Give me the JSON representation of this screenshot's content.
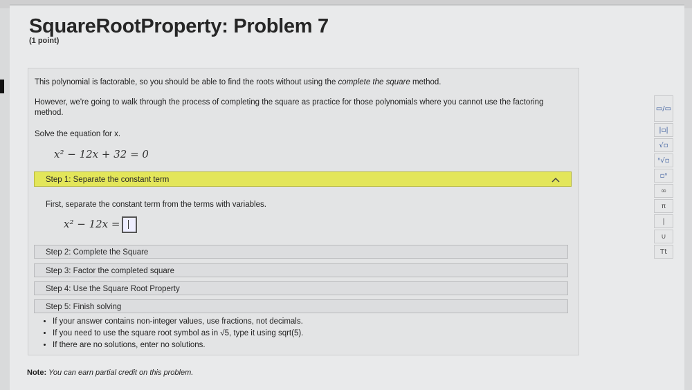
{
  "header": {
    "title": "SquareRootProperty: Problem 7",
    "points": "(1 point)"
  },
  "problem": {
    "intro_1_plain": "This polynomial is factorable, so you should be able to find the roots without using the ",
    "intro_1_em": "complete the square",
    "intro_1_end": " method.",
    "intro_2_line1": "However, we're going to walk through the process of completing the square as practice for those polynomials where you cannot use the factoring",
    "intro_2_line2": "method.",
    "instruction": "Solve the equation for x.",
    "equation": "x² − 12x + 32 = 0"
  },
  "steps": [
    {
      "label": "Step 1: Separate the constant term",
      "expanded": true
    },
    {
      "label": "Step 2: Complete the Square",
      "expanded": false
    },
    {
      "label": "Step 3: Factor the completed square",
      "expanded": false
    },
    {
      "label": "Step 4: Use the Square Root Property",
      "expanded": false
    },
    {
      "label": "Step 5: Finish solving",
      "expanded": false
    }
  ],
  "step1": {
    "text": "First, separate the constant term from the terms with variables.",
    "lhs": "x² − 12x =",
    "answer_value": ""
  },
  "hints": [
    "If your answer contains non-integer values, use fractions, not decimals.",
    "If you need to use the square root symbol as in √5, type it using sqrt(5).",
    "If there are no solutions, enter no solutions."
  ],
  "note": {
    "label": "Note:",
    "text": "You can earn partial credit on this problem."
  },
  "toolbar": {
    "buttons": [
      {
        "name": "fraction-icon",
        "glyph": "▭/▭"
      },
      {
        "name": "absolute-value-icon",
        "glyph": "|▫|"
      },
      {
        "name": "square-root-icon",
        "glyph": "√▫"
      },
      {
        "name": "nth-root-icon",
        "glyph": "ⁿ√▫"
      },
      {
        "name": "exponent-icon",
        "glyph": "▫ⁿ"
      },
      {
        "name": "infinity-icon",
        "glyph": "∞"
      },
      {
        "name": "pi-icon",
        "glyph": "π"
      },
      {
        "name": "vertical-bar-icon",
        "glyph": "|"
      },
      {
        "name": "union-icon",
        "glyph": "∪"
      },
      {
        "name": "text-format-icon",
        "glyph": "Tt"
      }
    ]
  },
  "colors": {
    "active_step_bg": "#e3e65a",
    "toolbar_accent": "#3b5d9e"
  }
}
